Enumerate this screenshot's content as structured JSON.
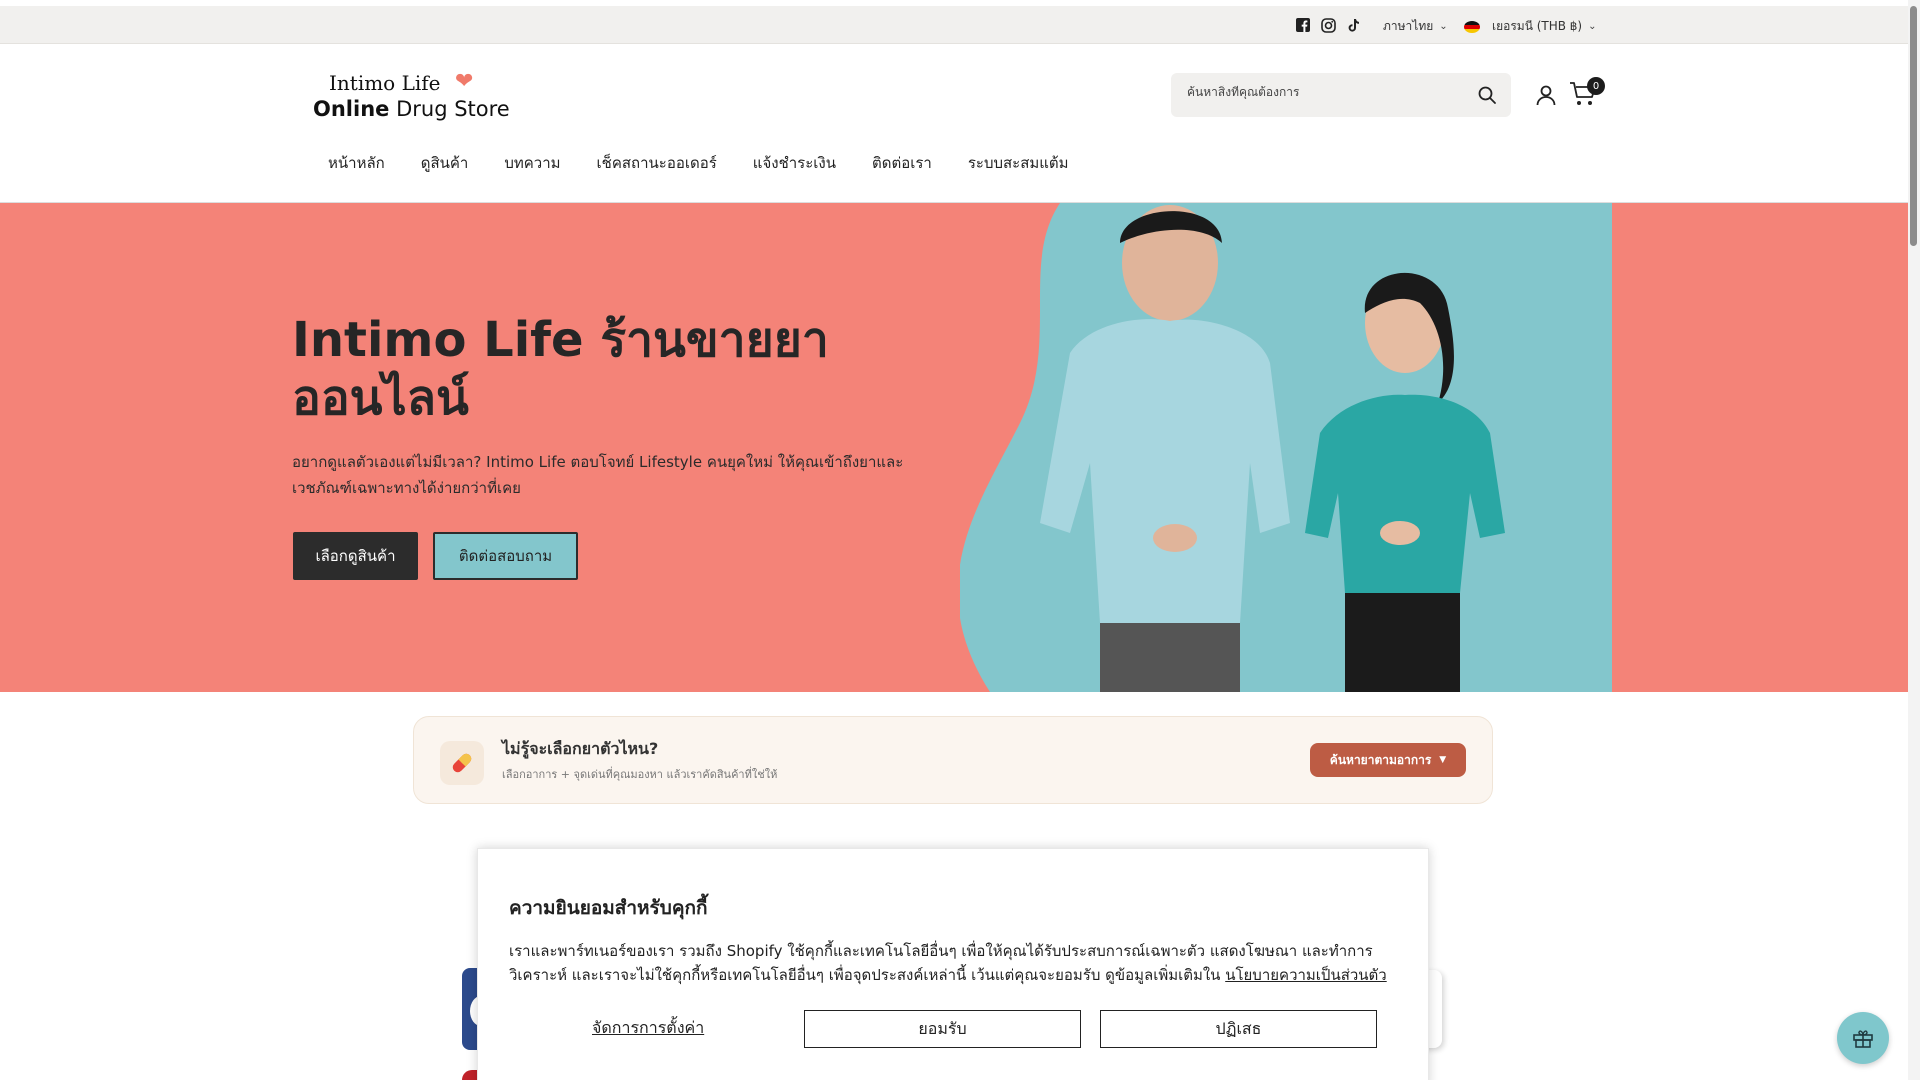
{
  "topbar": {
    "social": [
      "facebook-icon",
      "instagram-icon",
      "tiktok-icon"
    ],
    "language": "ภาษาไทย",
    "currency": "เยอรมนี (THB ฿)"
  },
  "header": {
    "logo_line1": "Intimo Life",
    "logo_line2_bold": "Online",
    "logo_line2_rest": " Drug Store",
    "search_placeholder": "ค้นหาสิ่งที่คุณต้องการ",
    "cart_count": "0"
  },
  "nav": {
    "items": [
      "หน้าหลัก",
      "ดูสินค้า",
      "บทความ",
      "เช็คสถานะออเดอร์",
      "แจ้งชำระเงิน",
      "ติดต่อเรา",
      "ระบบสะสมแต้ม"
    ]
  },
  "hero": {
    "title": "Intimo Life ร้านขายยาออนไลน์",
    "description": "อยากดูแลตัวเองแต่ไม่มีเวลา? Intimo Life ตอบโจทย์ Lifestyle คนยุคใหม่ ให้คุณเข้าถึงยาและเวชภัณฑ์เฉพาะทางได้ง่ายกว่าที่เคย",
    "primary_button": "เลือกดูสินค้า",
    "secondary_button": "ติดต่อสอบถาม",
    "background_color": "#f48378",
    "art_color": "#83c6cc"
  },
  "helper": {
    "title": "ไม่รู้จะเลือกยาตัวไหน?",
    "subtitle": "เลือกอาการ + จุดเด่นที่คุณมองหา แล้วเราคัดสินค้าที่ใช่ให้",
    "button": "ค้นหายาตามอาการ",
    "button_color": "#bd5c44"
  },
  "cookie": {
    "title": "ความยินยอมสำหรับคุกกี้",
    "body_line1": "เราและพาร์ทเนอร์ของเรา รวมถึง Shopify ใช้คุกกี้และเทคโนโลยีอื่นๆ เพื่อให้คุณได้รับประสบการณ์เฉพาะตัว แสดงโฆษณา และทำการ",
    "body_line2": "วิเคราะห์ และเราจะไม่ใช้คุกกี้หรือเทคโนโลยีอื่นๆ เพื่อจุดประสงค์เหล่านี้ เว้นแต่คุณจะยอมรับ ดูข้อมูลเพิ่มเติมใน ",
    "privacy_link": "นโยบายความเป็นส่วนตัว",
    "manage": "จัดการการตั้งค่า",
    "accept": "ยอมรับ",
    "reject": "ปฏิเสธ"
  }
}
